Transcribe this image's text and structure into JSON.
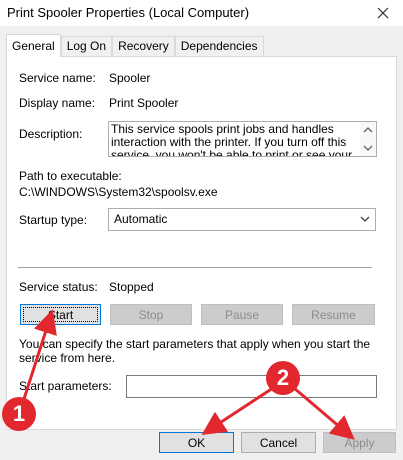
{
  "window": {
    "title": "Print Spooler Properties (Local Computer)"
  },
  "tabs": [
    {
      "label": "General",
      "active": true
    },
    {
      "label": "Log On"
    },
    {
      "label": "Recovery"
    },
    {
      "label": "Dependencies"
    }
  ],
  "general": {
    "service_name_label": "Service name:",
    "service_name_value": "Spooler",
    "display_name_label": "Display name:",
    "display_name_value": "Print Spooler",
    "description_label": "Description:",
    "description_value": "This service spools print jobs and handles interaction with the printer.  If you turn off this service, you won't be able to print or see your printers.",
    "path_label": "Path to executable:",
    "path_value": "C:\\WINDOWS\\System32\\spoolsv.exe",
    "startup_type_label": "Startup type:",
    "startup_type_value": "Automatic",
    "service_status_label": "Service status:",
    "service_status_value": "Stopped",
    "buttons": {
      "start": "Start",
      "stop": "Stop",
      "pause": "Pause",
      "resume": "Resume"
    },
    "hint_text": "You can specify the start parameters that apply when you start the service from here.",
    "start_parameters_label": "Start parameters:",
    "start_parameters_value": ""
  },
  "footer": {
    "ok": "OK",
    "cancel": "Cancel",
    "apply": "Apply"
  },
  "annotations": {
    "badge_1": "1",
    "badge_2": "2",
    "color": "#e2272e"
  }
}
